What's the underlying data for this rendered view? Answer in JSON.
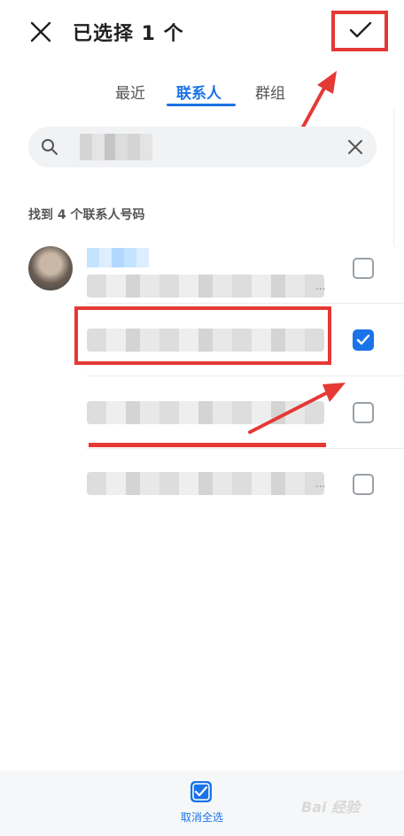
{
  "header": {
    "title": "已选择 1 个",
    "close_icon": "close-icon",
    "confirm_icon": "check-icon"
  },
  "tabs": [
    {
      "label": "最近",
      "active": false
    },
    {
      "label": "联系人",
      "active": true
    },
    {
      "label": "群组",
      "active": false
    }
  ],
  "search": {
    "search_icon": "search-icon",
    "clear_icon": "clear-icon"
  },
  "results": {
    "label": "找到 4 个联系人号码"
  },
  "contacts": [
    {
      "ellipsis": "...",
      "checked": false
    },
    {
      "ellipsis": "...",
      "checked": true
    },
    {
      "ellipsis": "...",
      "checked": false
    },
    {
      "ellipsis": "...",
      "checked": false
    }
  ],
  "bottom": {
    "deselect_label": "取消全选",
    "watermark": "Bai 经验"
  },
  "colors": {
    "accent": "#1a73e8",
    "annotation": "#e53935"
  }
}
